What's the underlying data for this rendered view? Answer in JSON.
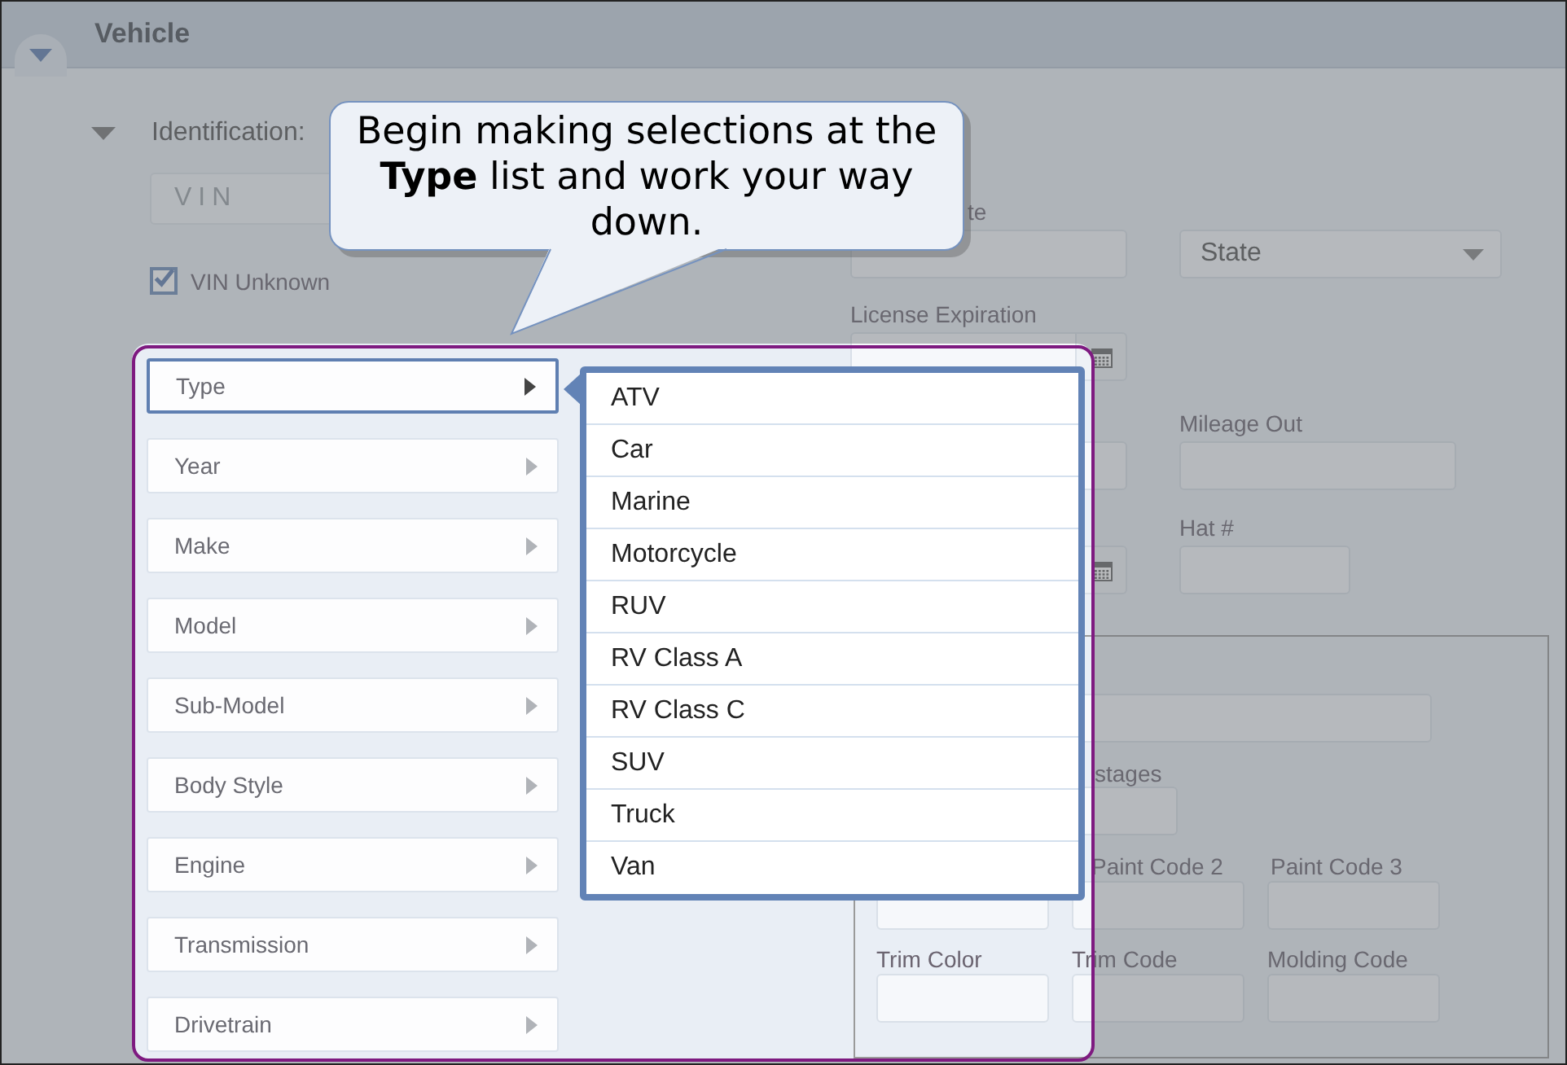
{
  "header": {
    "title": "Vehicle",
    "expanded": true
  },
  "section": {
    "title": "Identification:",
    "expanded": true
  },
  "vin_field": {
    "placeholder": "VIN"
  },
  "vin_unknown": {
    "label": "VIN Unknown",
    "checked": true
  },
  "selectors": [
    {
      "label": "Type",
      "selected": true
    },
    {
      "label": "Year",
      "selected": false
    },
    {
      "label": "Make",
      "selected": false
    },
    {
      "label": "Model",
      "selected": false
    },
    {
      "label": "Sub-Model",
      "selected": false
    },
    {
      "label": "Body Style",
      "selected": false
    },
    {
      "label": "Engine",
      "selected": false
    },
    {
      "label": "Transmission",
      "selected": false
    },
    {
      "label": "Drivetrain",
      "selected": false
    }
  ],
  "type_list": [
    "ATV",
    "Car",
    "Marine",
    "Motorcycle",
    "RUV",
    "RV Class A",
    "RV Class C",
    "SUV",
    "Truck",
    "Van"
  ],
  "right_fields": {
    "license_plate_label": "te",
    "state_select": "State",
    "license_expiration_label": "License Expiration",
    "mileage_out_label": "Mileage Out",
    "hat_label": "Hat #"
  },
  "paint_group": {
    "stages_label": "stages",
    "paint_code_2_label": "Paint Code 2",
    "paint_code_3_label": "Paint Code 3",
    "trim_color_label": "Trim Color",
    "trim_code_label": "Trim Code",
    "molding_code_label": "Molding Code"
  },
  "callout": {
    "text": "Begin making selections at the **Type** list and work your way down."
  }
}
